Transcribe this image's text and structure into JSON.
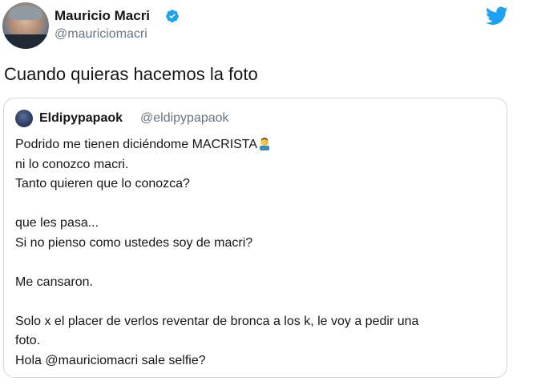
{
  "tweet": {
    "author": {
      "display_name": "Mauricio Macri",
      "handle": "@mauriciomacri",
      "verified": true
    },
    "text": "Cuando quieras hacemos la foto",
    "brand_icon": "twitter-bird-icon",
    "colors": {
      "brand": "#1da1f2",
      "text": "#14171a",
      "secondary_text": "#657786",
      "border": "#ccd6dd"
    }
  },
  "quoted": {
    "display_name": "Eldipypapaok",
    "handle": "@eldipypapaok",
    "lines": [
      "Podrido me tienen diciéndome MACRISTA",
      "ni lo conozco macri.",
      "Tanto quieren que lo conozca?",
      "",
      "que les pasa...",
      "Si no pienso como ustedes soy de macri?",
      "",
      "Me cansaron.",
      "",
      "Solo x el placer de verlos reventar de bronca a los k, le voy a pedir una",
      "foto.",
      "Hola @mauriciomacri sale selfie?"
    ],
    "emoji_icon": "facepalm-emoji-icon"
  }
}
